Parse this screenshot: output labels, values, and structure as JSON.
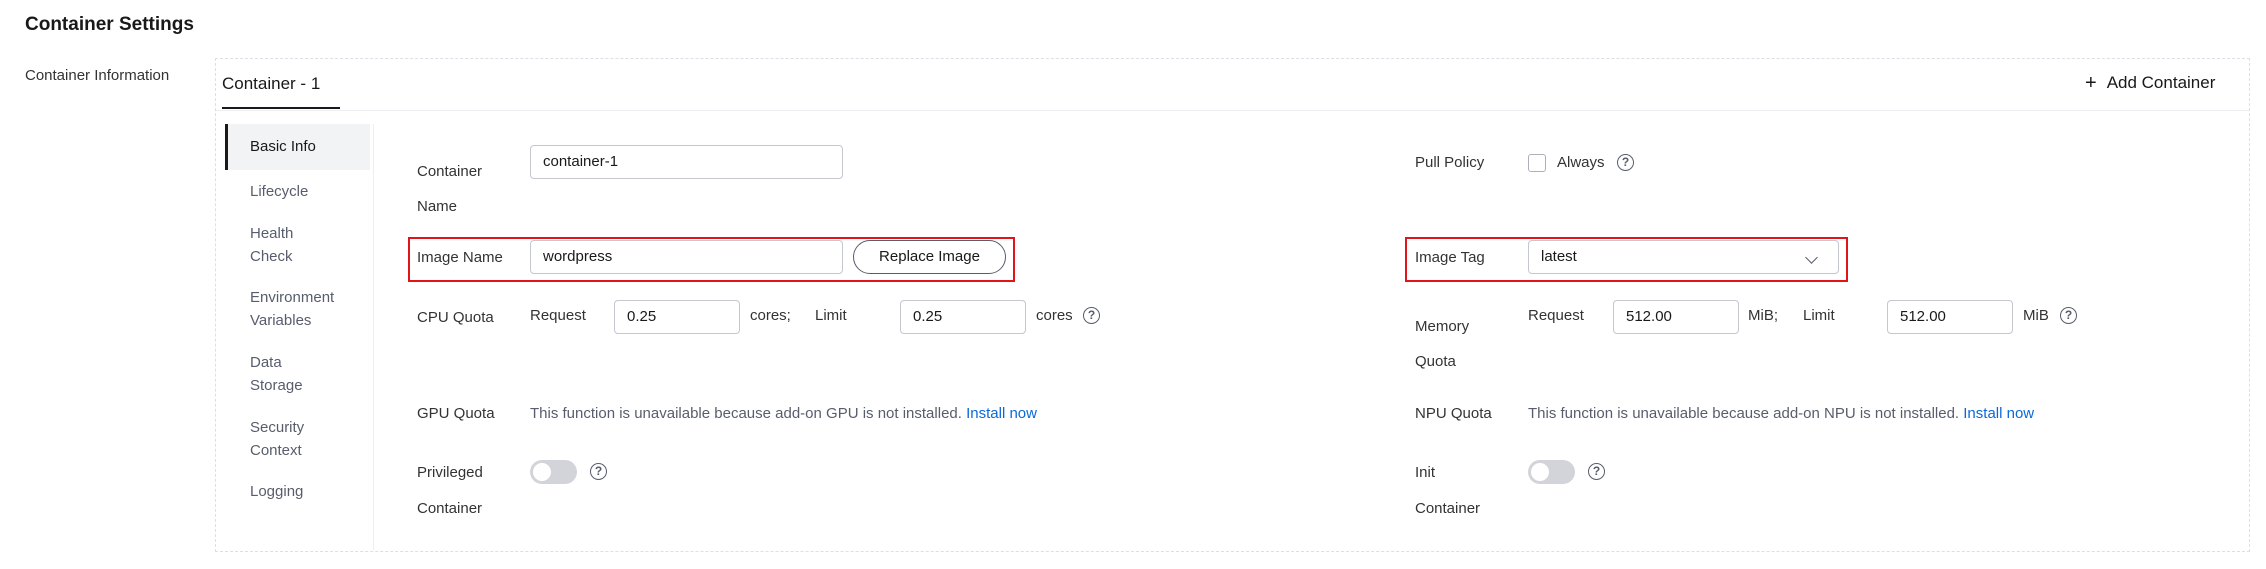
{
  "page": {
    "title": "Container Settings",
    "section_label": "Container Information"
  },
  "tabs": {
    "active_label": "Container - 1",
    "add_label": "Add Container"
  },
  "subnav": {
    "items": [
      {
        "label": "Basic Info"
      },
      {
        "label": "Lifecycle"
      },
      {
        "label": "Health Check"
      },
      {
        "label": "Environment Variables"
      },
      {
        "label": "Data Storage"
      },
      {
        "label": "Security Context"
      },
      {
        "label": "Logging"
      }
    ]
  },
  "form": {
    "container_name": {
      "label": "Container Name",
      "value": "container-1"
    },
    "pull_policy": {
      "label": "Pull Policy",
      "option": "Always",
      "checked": false
    },
    "image_name": {
      "label": "Image Name",
      "value": "wordpress",
      "button": "Replace Image"
    },
    "image_tag": {
      "label": "Image Tag",
      "value": "latest"
    },
    "cpu_quota": {
      "label": "CPU Quota",
      "request_label": "Request",
      "request_value": "0.25",
      "request_unit": "cores;",
      "limit_label": "Limit",
      "limit_value": "0.25",
      "limit_unit": "cores"
    },
    "memory_quota": {
      "label": "Memory Quota",
      "request_label": "Request",
      "request_value": "512.00",
      "request_unit": "MiB;",
      "limit_label": "Limit",
      "limit_value": "512.00",
      "limit_unit": "MiB"
    },
    "gpu_quota": {
      "label": "GPU Quota",
      "message": "This function is unavailable because add-on GPU is not installed.",
      "link": "Install now"
    },
    "npu_quota": {
      "label": "NPU Quota",
      "message": "This function is unavailable because add-on NPU is not installed.",
      "link": "Install now"
    },
    "privileged_container": {
      "label_line1": "Privileged",
      "label_line2": "Container",
      "enabled": false
    },
    "init_container": {
      "label_line1": "Init",
      "label_line2": "Container",
      "enabled": false
    }
  },
  "colors": {
    "highlight": "#e0141b",
    "link": "#0a69d9",
    "text": "#191919"
  },
  "icons": {
    "help": "help-circle-icon",
    "add": "plus-icon",
    "dropdown": "chevron-down-icon"
  }
}
